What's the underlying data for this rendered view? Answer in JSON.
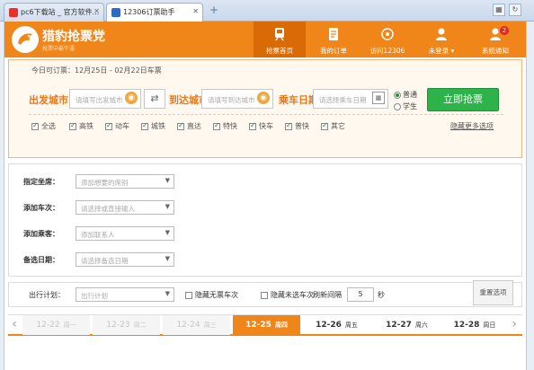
{
  "browser": {
    "tabs": [
      {
        "label": "pc6下载站 _ 官方软件..."
      },
      {
        "label": "12306订票助手"
      }
    ],
    "new_tab": "+"
  },
  "app": {
    "logo_title": "猎豹抢票党",
    "logo_subtitle": "抢票中最牛逼",
    "nav": [
      {
        "label": "抢票首页",
        "icon": "train-icon"
      },
      {
        "label": "我的订单",
        "icon": "orders-icon"
      },
      {
        "label": "访问12306",
        "icon": "globe-icon"
      },
      {
        "label": "未登录 ▾",
        "icon": "user-icon"
      },
      {
        "label": "系统通知",
        "icon": "bell-icon",
        "badge": "2"
      }
    ]
  },
  "search": {
    "today": "今日可订票：12月25日 - 02月22日车票",
    "from_label": "出发城市",
    "from_placeholder": "请填写出发城市",
    "swap": "⇄",
    "to_label": "到达城市",
    "to_placeholder": "请填写到达城市",
    "date_label": "乘车日期",
    "date_placeholder": "请选择乘车日期",
    "radio_normal": "普通",
    "radio_student": "学生",
    "grab_button": "立即抢票",
    "filters": [
      "全选",
      "高铁",
      "动车",
      "城铁",
      "直达",
      "特快",
      "快车",
      "普快",
      "其它"
    ],
    "more_options": "隐藏更多选项"
  },
  "form": {
    "seat_label": "指定坐席：",
    "seat_placeholder": "添加想要的席别",
    "train_label": "添加车次：",
    "train_placeholder": "请选择或直接输入",
    "passenger_label": "添加乘客：",
    "passenger_placeholder": "添加联系人",
    "backup_label": "备选日期：",
    "backup_placeholder": "请选择备选日期"
  },
  "plan": {
    "label": "出行计划：",
    "placeholder": "出行计划",
    "hide_no_ticket": "隐藏无票车次",
    "hide_unselected": "隐藏未选车次",
    "refresh_label": "刷新间隔",
    "refresh_value": "5",
    "seconds": "秒",
    "reset": "重置选项"
  },
  "dates": [
    {
      "date": "12-22",
      "week": "周一"
    },
    {
      "date": "12-23",
      "week": "周二"
    },
    {
      "date": "12-24",
      "week": "周三"
    },
    {
      "date": "12-25",
      "week": "周四"
    },
    {
      "date": "12-26",
      "week": "周五"
    },
    {
      "date": "12-27",
      "week": "周六"
    },
    {
      "date": "12-28",
      "week": "周日"
    }
  ],
  "colors": {
    "accent": "#f08519",
    "grab": "#2eb34a",
    "badge": "#e02525"
  }
}
